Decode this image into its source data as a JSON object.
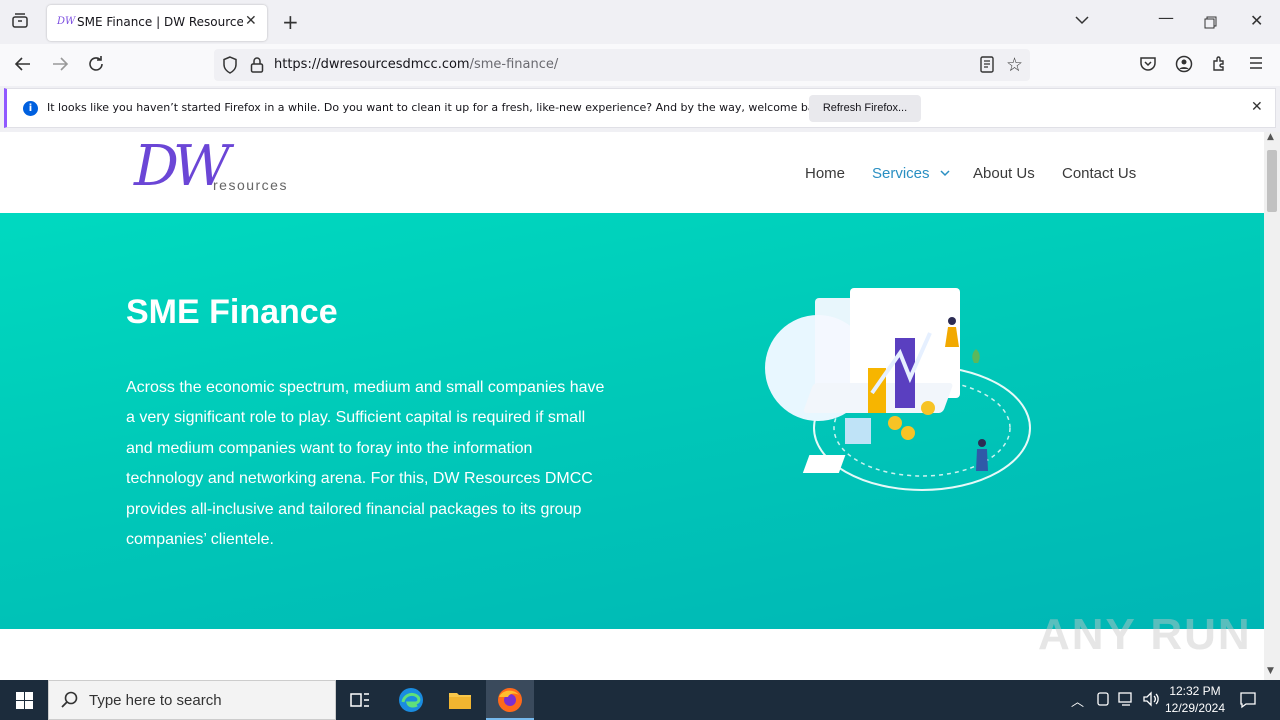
{
  "browser": {
    "tab_title": "SME Finance | DW Resources DMCC",
    "tab_favicon": "DW",
    "url_host": "https://dwresourcesdmcc.com",
    "url_path": "/sme-finance/"
  },
  "notification": {
    "text": "It looks like you haven’t started Firefox in a while. Do you want to clean it up for a fresh, like-new experience? And by the way, welcome back!",
    "button": "Refresh Firefox..."
  },
  "site": {
    "logo_main": "DW",
    "logo_sub": "resources",
    "nav": [
      "Home",
      "Services",
      "About Us",
      "Contact Us"
    ],
    "hero_title": "SME Finance",
    "hero_text": "Across the economic spectrum, medium and small companies have a very significant role to play. Sufficient capital is required if small and medium companies want to foray into the information technology and networking arena. For this, DW Resources DMCC provides all-inclusive and tailored financial packages to its group companies’ clientele."
  },
  "taskbar": {
    "search_placeholder": "Type here to search",
    "time": "12:32 PM",
    "date": "12/29/2024"
  },
  "watermark": "ANY RUN",
  "colors": {
    "hero_start": "#00d9c0",
    "hero_end": "#00b6b5",
    "nav_active": "#2a8fc2",
    "logo": "#6b46d6"
  }
}
